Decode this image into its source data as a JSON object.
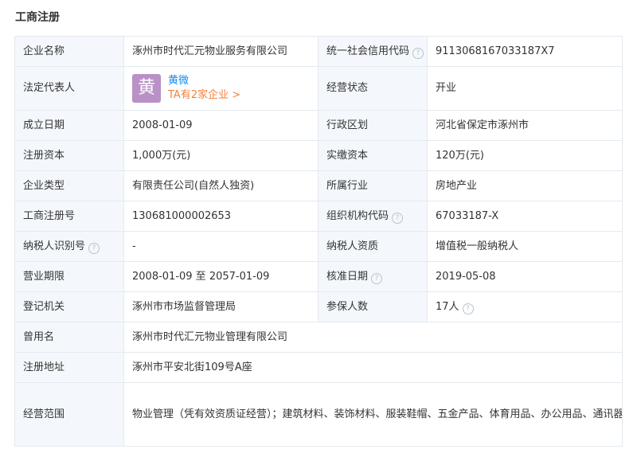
{
  "section": {
    "title": "工商注册"
  },
  "rows": {
    "company_name": {
      "label": "企业名称",
      "value": "涿州市时代汇元物业服务有限公司"
    },
    "credit_code": {
      "label": "统一社会信用代码",
      "value": "9113068167033187X7"
    },
    "legal_rep": {
      "label": "法定代表人",
      "avatar_char": "黄",
      "name": "黄微",
      "link": "TA有2家企业 >"
    },
    "status": {
      "label": "经营状态",
      "value": "开业"
    },
    "established": {
      "label": "成立日期",
      "value": "2008-01-09"
    },
    "region": {
      "label": "行政区划",
      "value": "河北省保定市涿州市"
    },
    "reg_capital": {
      "label": "注册资本",
      "value": "1,000万(元)"
    },
    "paid_capital": {
      "label": "实缴资本",
      "value": "120万(元)"
    },
    "company_type": {
      "label": "企业类型",
      "value": "有限责任公司(自然人独资)"
    },
    "industry": {
      "label": "所属行业",
      "value": "房地产业"
    },
    "reg_number": {
      "label": "工商注册号",
      "value": "130681000002653"
    },
    "org_code": {
      "label": "组织机构代码",
      "value": "67033187-X"
    },
    "taxpayer_id": {
      "label": "纳税人识别号",
      "value": "-"
    },
    "taxpayer_qual": {
      "label": "纳税人资质",
      "value": "增值税一般纳税人"
    },
    "business_term": {
      "label": "营业期限",
      "value": "2008-01-09 至 2057-01-09"
    },
    "approval_date": {
      "label": "核准日期",
      "value": "2019-05-08"
    },
    "authority": {
      "label": "登记机关",
      "value": "涿州市市场监督管理局"
    },
    "insured": {
      "label": "参保人数",
      "value": "17人"
    },
    "former_name": {
      "label": "曾用名",
      "value": "涿州市时代汇元物业管理有限公司"
    },
    "address": {
      "label": "注册地址",
      "value": "涿州市平安北街109号A座"
    },
    "scope": {
      "label": "经营范围",
      "value": "物业管理（凭有效资质证经营）；建筑材料、装饰材料、服装鞋帽、五金产品、体育用品、办公用品、通讯器材、机电产品、计算机软、硬件及耗材、金属材料销售、国内广告设计、制作、发布、代理；家庭服务（不含劳务派遣）；清洁服务；家用电器维修（依法须经批准的项目，经相关部门批准后方可开展经营活动）"
    }
  },
  "colors": {
    "label_bg": "#f4f8fd",
    "border": "#e4eaf0",
    "link_blue": "#128bed",
    "link_orange": "#f2823c",
    "avatar_bg": "#b991c6"
  },
  "icons": {
    "help": "question-circle-icon"
  }
}
